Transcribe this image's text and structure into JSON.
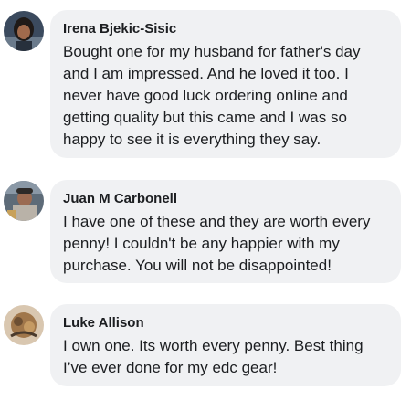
{
  "comments": [
    {
      "author": "Irena Bjekic-Sisic",
      "text": "Bought one for my husband for father's day and I am impressed. And he loved it too. I never have good luck ordering online and getting quality but this came and I was so happy to see it is everything they say.",
      "avatar_icon": "user-photo-avatar"
    },
    {
      "author": "Juan M Carbonell",
      "text": "I have one of these and they are worth every penny! I couldn't be any happier with my purchase. You will not be disappointed!",
      "avatar_icon": "user-photo-avatar"
    },
    {
      "author": "Luke Allison",
      "text": "I own one. Its worth every penny. Best thing I’ve ever done for my edc gear!",
      "avatar_icon": "user-photo-avatar"
    }
  ],
  "colors": {
    "bubble_background": "#f0f1f3",
    "text": "#1c1e21",
    "page_background": "#ffffff"
  }
}
